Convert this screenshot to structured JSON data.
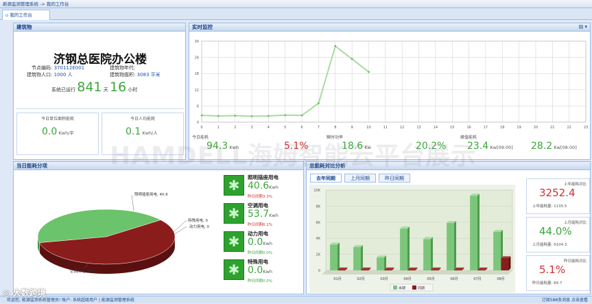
{
  "breadcrumb": "新源监测管理系统 -> 我的工作台",
  "tab_label": "我的工作台",
  "building_panel": {
    "title": "建筑物",
    "name": "济钢总医院办公楼",
    "node_label": "节点编码:",
    "node_value": "370112E001",
    "year_label": "建筑物年代:",
    "year_value": "",
    "pop_label": "建筑物人口:",
    "pop_value": "1000",
    "pop_unit": "人",
    "area_label": "建筑物面积:",
    "area_value": "3083",
    "area_unit": "平米",
    "uptime_prefix": "系统已运行",
    "uptime_days": "841",
    "days_unit": "天",
    "uptime_hours": "16",
    "hours_unit": "小时",
    "unit_area_label": "今日单位面积能耗",
    "unit_area_value": "0.0",
    "unit_area_unit": "Kwh/平",
    "per_person_label": "今日人均能耗",
    "per_person_value": "0.1",
    "per_person_unit": "Kwh/人"
  },
  "realtime_panel": {
    "title": "实时监控",
    "menu_glyph": "▤ ▾",
    "today_label": "今日能耗",
    "today_value": "94.3",
    "today_unit": "Kwh",
    "today_pct": "5.1%",
    "instant_label": "瞬时功率",
    "instant_value": "18.6",
    "instant_unit": "Kw",
    "instant_pct": "20.2%",
    "peak_label": "峰值能耗",
    "peak1_value": "23.4",
    "peak1_unit": "Kw[09:00]",
    "peak2_value": "28.2",
    "peak2_unit": "Kw[08:00]"
  },
  "daily_panel": {
    "title": "当日能耗分项",
    "pie_labels": {
      "lighting": "照明插座用电, 40.6",
      "special": "特殊用电, 0",
      "power": "动力用电, 0",
      "ac": "空调用电, 53.7"
    },
    "items": [
      {
        "name": "照明插座用电",
        "value": "40.6",
        "unit": "Kwh",
        "compare": "昨日同期3.3%",
        "compare_color": "red"
      },
      {
        "name": "空调用电",
        "value": "53.7",
        "unit": "Kwh",
        "compare": "昨日同期6.1%",
        "compare_color": "red"
      },
      {
        "name": "动力用电",
        "value": "0.0",
        "unit": "Kwh",
        "compare": "昨日同期0.0%",
        "compare_color": "green"
      },
      {
        "name": "特殊用电",
        "value": "0.0",
        "unit": "Kwh",
        "compare": "昨日同期0.0%",
        "compare_color": "green"
      }
    ]
  },
  "compare_panel": {
    "title": "总能耗对比分析",
    "tabs": [
      "去年同期",
      "上月同期",
      "昨日同期"
    ],
    "legend_current": "本期",
    "legend_previous": "同期",
    "side": [
      {
        "label": "上年能耗对比",
        "value": "3252.4",
        "sub": "上年能耗量: 1135.5",
        "color": "red"
      },
      {
        "label": "上月能耗对比",
        "value": "44.0%",
        "sub": "上月能耗量: 9104.3",
        "color": "green"
      },
      {
        "label": "昨日能耗对比",
        "value": "5.1%",
        "sub": "昨日能耗量: 89.7",
        "color": "red"
      }
    ]
  },
  "watermark": "HAMDELL海姆智能云平台展示",
  "status": {
    "left": "欢迎您, 能源监测系统管理员! 账户: 系统超级用户 | 能源监测管理系统",
    "right": "订阅588条消息 点击查看"
  },
  "logo_text": "大数跨境",
  "chart_data": [
    {
      "type": "line",
      "title": "实时监控",
      "x": [
        0,
        1,
        2,
        3,
        4,
        5,
        6,
        7,
        8,
        9,
        10
      ],
      "values": [
        2.5,
        2.3,
        2.4,
        2.2,
        2.3,
        2.6,
        2.5,
        7,
        28.2,
        23.4,
        18.6
      ],
      "xticks": [
        0,
        1,
        2,
        3,
        4,
        5,
        6,
        7,
        8,
        9,
        10,
        11,
        12,
        13,
        14,
        15,
        16,
        17,
        18,
        19,
        20,
        21,
        22,
        23
      ],
      "yticks": [
        0,
        6,
        12,
        18,
        24,
        30
      ],
      "ylim": [
        0,
        30
      ],
      "xlim": [
        0,
        23
      ],
      "grid": true,
      "color": "#a8dca0"
    },
    {
      "type": "pie",
      "categories": [
        "照明插座用电",
        "空调用电",
        "特殊用电",
        "动力用电"
      ],
      "values": [
        40.6,
        53.7,
        0,
        0
      ],
      "colors": [
        "#6bc36b",
        "#8b1c1c",
        "#cccccc",
        "#cccccc"
      ]
    },
    {
      "type": "bar",
      "categories": [
        "01月",
        "02月",
        "03月",
        "04月",
        "05月",
        "06月",
        "07月",
        "08月"
      ],
      "series": [
        {
          "name": "本期",
          "values": [
            3.2,
            2.9,
            1.6,
            5.2,
            3.9,
            5.9,
            9.3,
            4.8
          ],
          "color": "#7cc67c"
        },
        {
          "name": "同期",
          "values": [
            0.1,
            0.1,
            0.1,
            0.1,
            0.1,
            0.1,
            0.1,
            1.5
          ],
          "color": "#8b1c1c"
        }
      ],
      "yticks_labels": [
        "0",
        "2K",
        "4K",
        "6K",
        "8K",
        "10K"
      ],
      "yticks": [
        0,
        2,
        4,
        6,
        8,
        10
      ],
      "ylim": [
        0,
        10
      ],
      "grid": true,
      "legend": "bottom"
    }
  ]
}
